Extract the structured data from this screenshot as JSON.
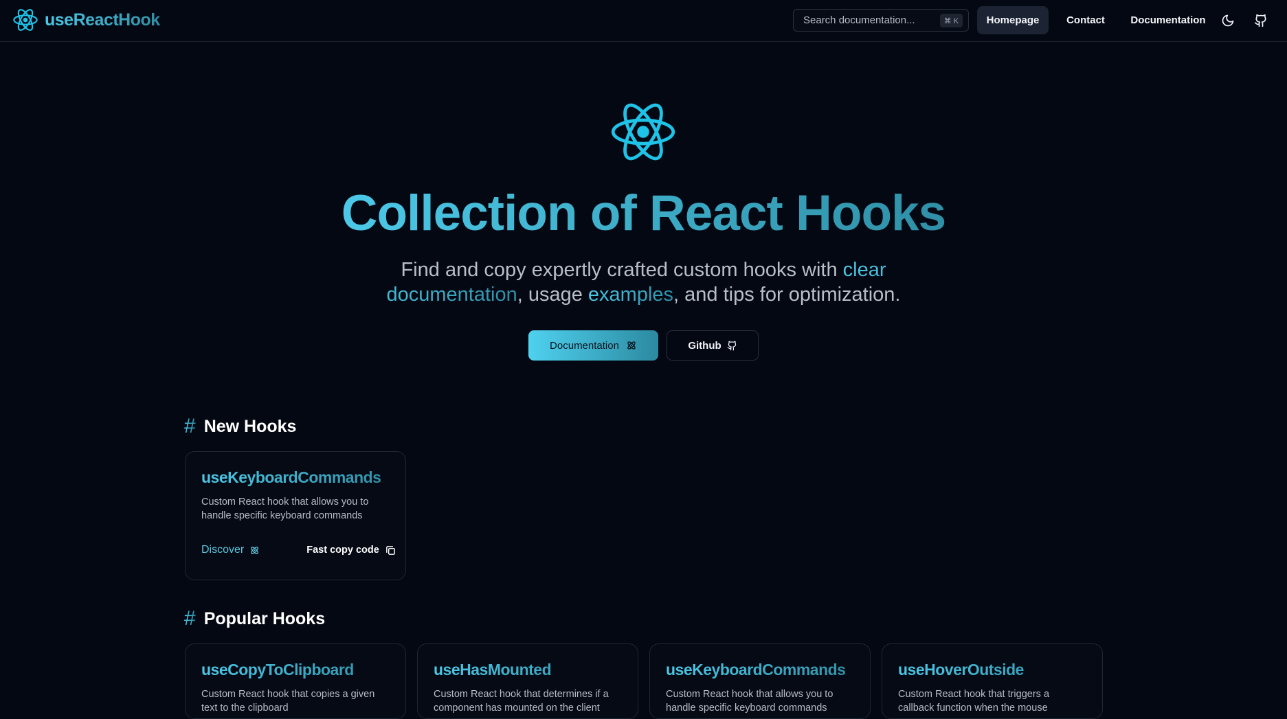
{
  "header": {
    "brand": "useReactHook",
    "search_placeholder": "Search documentation...",
    "search_shortcut": "⌘ K",
    "nav": [
      {
        "label": "Homepage",
        "active": true
      },
      {
        "label": "Contact",
        "active": false
      },
      {
        "label": "Documentation",
        "active": false
      }
    ],
    "theme_icon": "moon-icon",
    "github_icon": "github-icon"
  },
  "hero": {
    "title": "Collection of React Hooks",
    "subtitle_parts": [
      {
        "text": "Find and copy expertly crafted custom hooks with ",
        "highlight": false
      },
      {
        "text": "clear documentation",
        "highlight": true
      },
      {
        "text": ", usage ",
        "highlight": false
      },
      {
        "text": "examples",
        "highlight": true
      },
      {
        "text": ", and tips for optimization.",
        "highlight": false
      }
    ],
    "primary_button": "Documentation",
    "secondary_button": "Github"
  },
  "new_hooks": {
    "title": "New Hooks",
    "cards": [
      {
        "name": "useKeyboardCommands",
        "description": "Custom React hook that allows you to handle specific keyboard commands",
        "discover_label": "Discover",
        "copy_label": "Fast copy code"
      }
    ]
  },
  "popular_hooks": {
    "title": "Popular Hooks",
    "cards": [
      {
        "name": "useCopyToClipboard",
        "description": "Custom React hook that copies a given text to the clipboard"
      },
      {
        "name": "useHasMounted",
        "description": "Custom React hook that determines if a component has mounted on the client"
      },
      {
        "name": "useKeyboardCommands",
        "description": "Custom React hook that allows you to handle specific keyboard commands"
      },
      {
        "name": "useHoverOutside",
        "description": "Custom React hook that triggers a callback function when the mouse"
      }
    ]
  },
  "colors": {
    "background": "#040812",
    "accent_start": "#4cc9e8",
    "accent_end": "#2f8fa6",
    "react_logo": "#1fc3e8"
  }
}
